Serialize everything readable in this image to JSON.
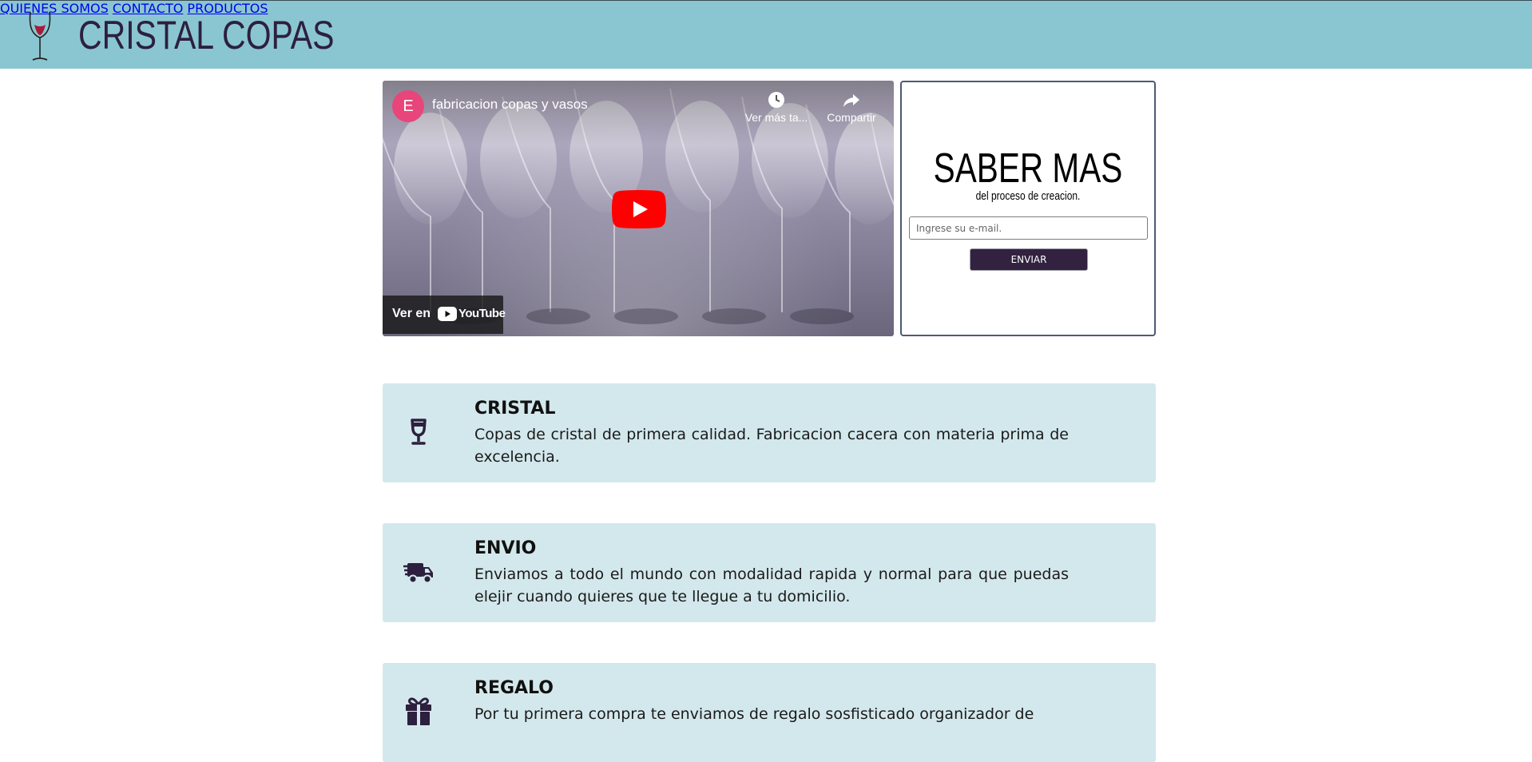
{
  "header": {
    "brand": "CRISTAL COPAS",
    "nav": [
      "QUIENES SOMOS",
      "CONTACTO",
      "PRODUCTOS"
    ]
  },
  "video": {
    "channel_initial": "E",
    "title": "fabricacion copas y vasos",
    "watch_later_label": "Ver más ta...",
    "share_label": "Compartir",
    "watch_on_label": "Ver en",
    "youtube_word": "YouTube"
  },
  "signup": {
    "title": "SABER MAS",
    "subtitle": "del proceso de creacion.",
    "email_placeholder": "Ingrese su e-mail.",
    "button_label": "ENVIAR"
  },
  "features": [
    {
      "icon": "wine-glass-icon",
      "title": "CRISTAL",
      "text": "Copas de cristal de primera calidad. Fabricacion cacera con materia prima de excelencia."
    },
    {
      "icon": "shipping-truck-icon",
      "title": "ENVIO",
      "text": "Enviamos a todo el mundo con modalidad rapida y normal para que puedas elejir cuando quieres que te llegue a tu domicilio."
    },
    {
      "icon": "gift-icon",
      "title": "REGALO",
      "text": "Por tu primera compra te enviamos de regalo sosfisticado organizador de"
    }
  ],
  "colors": {
    "header_bg": "#89c6d1",
    "brand_text": "#2d1f3e",
    "feature_bg": "#d3e8ec",
    "button_bg": "#32223f",
    "youtube_red": "#ff0000"
  }
}
